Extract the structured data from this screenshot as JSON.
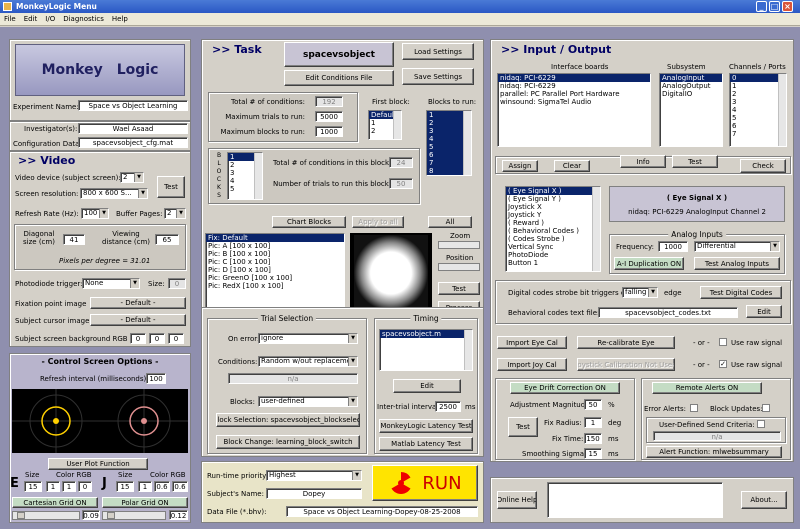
{
  "window": {
    "title": "MonkeyLogic Menu",
    "menu": [
      "File",
      "Edit",
      "I/O",
      "Diagnostics",
      "Help"
    ]
  },
  "left": {
    "logo": {
      "word1": "Monkey",
      "word2": "Logic"
    },
    "experiment_name_label": "Experiment Name:",
    "experiment_name": "Space vs Object Learning",
    "investigators_label": "Investigator(s):",
    "investigators": "Wael Asaad",
    "config_label": "Configuration Data:",
    "config": "spacevsobject_cfg.mat",
    "video": {
      "header": ">> Video",
      "device_label": "Video device (subject screen):",
      "device": "2",
      "resolution_label": "Screen resolution:",
      "resolution": "800 x 600  S...",
      "test": "Test",
      "refresh_label": "Refresh Rate (Hz):",
      "refresh": "100",
      "buffer_label": "Buffer Pages:",
      "buffer": "2",
      "diag_label": "Diagonal size (cm)",
      "diag": "41",
      "view_label": "Viewing distance (cm)",
      "view": "65",
      "ppd": "Pixels per degree  = 31.01"
    },
    "photodiode_label": "Photodiode trigger:",
    "photodiode": "None",
    "size_label": "Size:",
    "size": "0",
    "fix_label": "Fixation point image",
    "fix": "- Default -",
    "cursor_label": "Subject cursor image",
    "cursor": "- Default -",
    "bg_label": "Subject screen background RGB",
    "bg": [
      "0",
      "0",
      "0"
    ],
    "control": {
      "header": "- Control Screen Options -",
      "refresh_label": "Refresh interval (milliseconds):",
      "refresh": "100",
      "user_plot": "User Plot Function",
      "e_letter": "E",
      "j_letter": "J",
      "size_label": "Size",
      "color_label": "Color RGB",
      "e_size": "15",
      "e_rgb": [
        "1",
        "1",
        "0"
      ],
      "j_size": "15",
      "j_rgb": [
        "1",
        "0.6",
        "0.6"
      ],
      "cartesian": "Cartesian Grid ON",
      "polar": "Polar Grid ON",
      "slider1": "0.09",
      "slider2": "0.12"
    }
  },
  "task": {
    "header": ">> Task",
    "condition_file": "spacevsobject",
    "load": "Load Settings",
    "edit_cond": "Edit Conditions File",
    "save": "Save Settings",
    "total_cond_label": "Total # of conditions:",
    "total_cond": "192",
    "max_trials_label": "Maximum trials to run:",
    "max_trials": "5000",
    "max_blocks_label": "Maximum blocks to run:",
    "max_blocks": "1000",
    "first_block_label": "First block:",
    "first_block": [
      "Default",
      "1",
      "2"
    ],
    "blocks_to_run_label": "Blocks to run:",
    "blocks_to_run": [
      "1",
      "2",
      "3",
      "4",
      "5",
      "6",
      "7",
      "8"
    ],
    "blocks_letters": [
      "B",
      "L",
      "O",
      "C",
      "K",
      "S"
    ],
    "blocks_list": [
      "1",
      "2",
      "3",
      "4",
      "5"
    ],
    "cond_in_block_label": "Total # of conditions in this block:",
    "cond_in_block": "24",
    "trials_in_block_label": "Number of trials to run this block:",
    "trials_in_block": "50",
    "chart_blocks": "Chart Blocks",
    "apply_all": "Apply to all",
    "all": "All",
    "stimuli": [
      "Fix: Default",
      "Pic: A  [100 x 100]",
      "Pic: B  [100 x 100]",
      "Pic: C  [100 x 100]",
      "Pic: D  [100 x 100]",
      "Pic: GreenO  [100 x 100]",
      "Pic: RedX  [100 x 100]"
    ],
    "zoom": "Zoom",
    "position": "Position",
    "test": "Test",
    "process": "Process"
  },
  "trial_selection": {
    "caption": "Trial Selection",
    "on_error_label": "On error:",
    "on_error": "ignore",
    "conditions_label": "Conditions:",
    "conditions": "Random w/out replacement",
    "na": "n/a",
    "blocks_label": "Blocks:",
    "blocks": "user-defined",
    "block_selection": "Block Selection: spacevsobject_blockselect",
    "block_change": "Block Change: learning_block_switch"
  },
  "timing": {
    "caption": "Timing",
    "file": "spacevsobject.m",
    "edit": "Edit",
    "iti_label": "Inter-trial interval:",
    "iti": "2500",
    "iti_unit": "ms",
    "latency": "MonkeyLogic Latency Test",
    "matlab_latency": "Matlab Latency Test"
  },
  "run": {
    "priority_label": "Run-time priority:",
    "priority": "Highest",
    "subject_label": "Subject's Name:",
    "subject": "Dopey",
    "datafile_label": "Data File (*.bhv):",
    "datafile": "Space vs Object Learning-Dopey-08-25-2008",
    "run": "RUN"
  },
  "io": {
    "header": ">> Input / Output",
    "boards_label": "Interface boards",
    "subsystem_label": "Subsystem",
    "channels_label": "Channels / Ports",
    "boards": [
      "nidaq: PCI-6229",
      "nidaq: PCI-6229",
      "parallel: PC Parallel Port Hardware",
      "winsound: SigmaTel Audio"
    ],
    "subsystems": [
      "AnalogInput",
      "AnalogOutput",
      "DigitalIO"
    ],
    "channels": [
      "0",
      "1",
      "2",
      "3",
      "4",
      "5",
      "6",
      "7"
    ],
    "assign": "Assign",
    "clear": "Clear",
    "info": "Info",
    "test": "Test",
    "check": "Check",
    "signals": [
      "( Eye Signal X )",
      "( Eye Signal Y )",
      "Joystick X",
      "Joystick Y",
      "( Reward )",
      "( Behavioral Codes )",
      "( Codes Strobe )",
      "Vertical Sync",
      "PhotoDiode",
      "Button 1"
    ],
    "signal_title": "( Eye Signal X )",
    "signal_desc": "nidaq: PCI-6229  AnalogInput  Channel 2",
    "analog_caption": "Analog Inputs",
    "frequency_label": "Frequency:",
    "frequency": "1000",
    "mode": "Differential",
    "ai_dup": "A-I Duplication ON",
    "test_analog": "Test Analog Inputs",
    "strobe_label": "Digital codes strobe bit triggers on:",
    "strobe": "falling",
    "edge": "edge",
    "test_digital": "Test Digital Codes",
    "codes_label": "Behavioral codes text file:",
    "codes": "spacevsobject_codes.txt",
    "edit": "Edit",
    "import_eye": "Import Eye Cal",
    "recal_eye": "Re-calibrate Eye",
    "or": "- or -",
    "raw": "Use raw signal",
    "import_joy": "Import Joy Cal",
    "joy_cal": "Joystick Calibration Not Used",
    "raw2": "Use raw signal",
    "drift": "Eye Drift Correction ON",
    "adj_label": "Adjustment Magnitude:",
    "adj": "50",
    "adj_unit": "%",
    "fix_radius_label": "Fix Radius:",
    "fix_radius": "1",
    "deg": "deg",
    "fix_time_label": "Fix Time:",
    "fix_time": "150",
    "ms": "ms",
    "smooth_label": "Smoothing Sigma:",
    "smooth": "15",
    "drift_test": "Test",
    "remote": "Remote Alerts ON",
    "error_alerts": "Error Alerts:",
    "block_updates": "Block Updates:",
    "user_send": "User-Defined Send Criteria:",
    "na": "n/a",
    "alert_fn": "Alert Function: mlwebsummary",
    "online_help": "Online Help",
    "about": "About..."
  }
}
